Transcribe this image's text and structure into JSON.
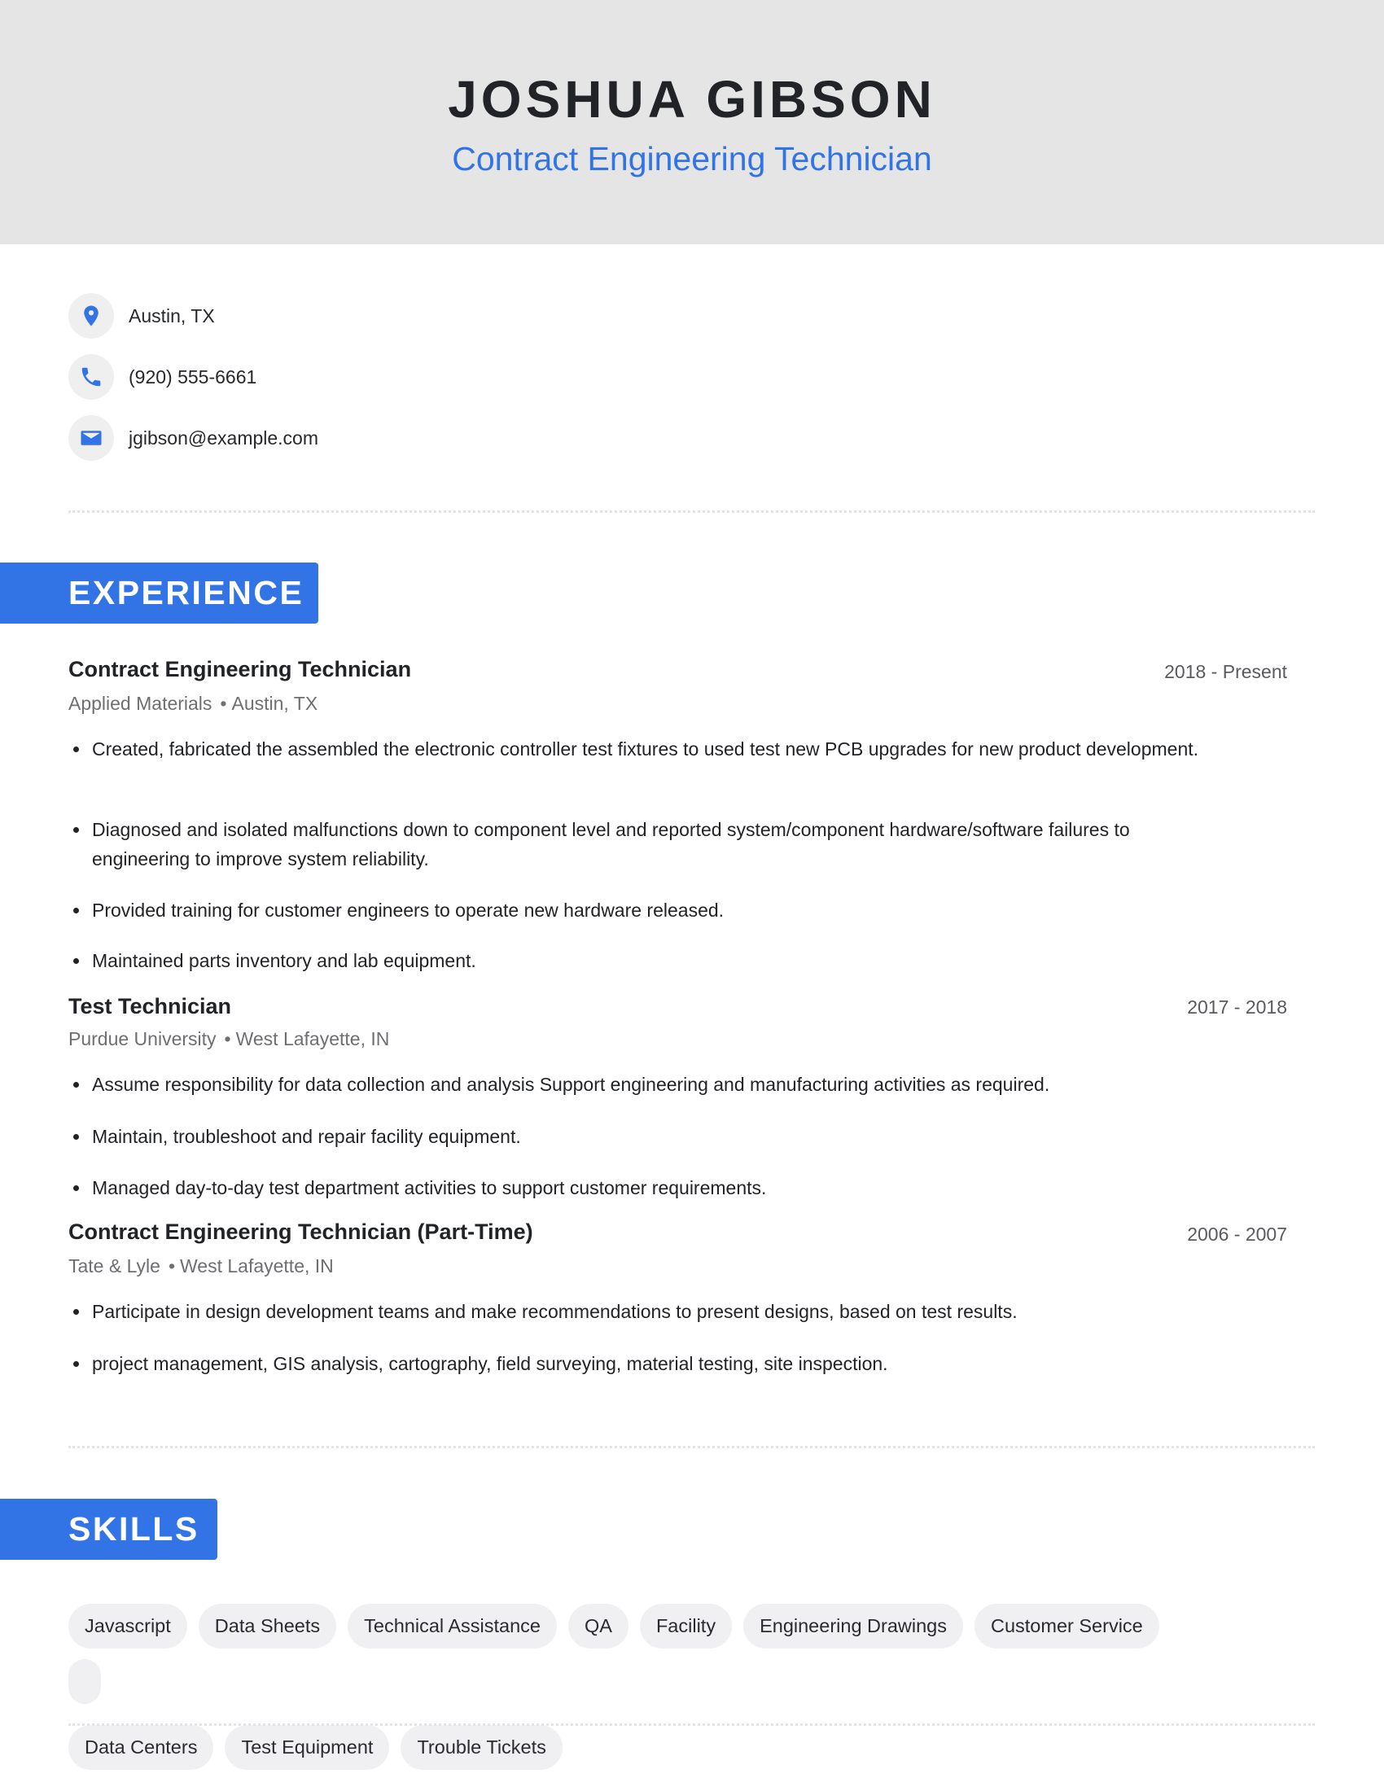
{
  "header": {
    "name": "JOSHUA GIBSON",
    "title": "Contract Engineering Technician"
  },
  "contact": {
    "location": {
      "icon": "location-pin-icon",
      "text": "Austin, TX"
    },
    "phone": {
      "icon": "phone-icon",
      "text": "(920) 555-6661"
    },
    "email": {
      "icon": "email-icon",
      "text": "jgibson@example.com"
    }
  },
  "colors": {
    "accent": "#3274e6",
    "header_bg": "#e5e5e6",
    "pill_bg": "#f0f0f2",
    "text": "#212327"
  },
  "experience": {
    "label": "EXPERIENCE",
    "jobs": [
      {
        "title": "Contract Engineering Technician",
        "dates": "2018 - Present",
        "company": "Applied Materials",
        "location": "Austin, TX",
        "bullets": [
          "Created, fabricated the assembled the electronic controller test fixtures to used test new PCB upgrades for new product development.",
          "Diagnosed and isolated malfunctions down to component level and reported system/component hardware/software failures to engineering to improve system reliability.",
          "Provided training for customer engineers to operate new hardware released.",
          "Maintained parts inventory and lab equipment."
        ]
      },
      {
        "title": "Test Technician",
        "dates": "2017 - 2018",
        "company": "Purdue University",
        "location": "West Lafayette, IN",
        "bullets": [
          "Assume responsibility for data collection and analysis Support engineering and manufacturing activities as required.",
          "Maintain, troubleshoot and repair facility equipment.",
          "Managed day-to-day test department activities to support customer requirements."
        ]
      },
      {
        "title": "Contract Engineering Technician (Part-Time)",
        "dates": "2006 - 2007",
        "company": "Tate & Lyle",
        "location": "West Lafayette, IN",
        "bullets": [
          "Participate in design development teams and make recommendations to present designs, based on test results.",
          "project management, GIS analysis, cartography, field surveying, material testing, site inspection."
        ]
      }
    ]
  },
  "skills": {
    "label": "SKILLS",
    "items": [
      "Javascript",
      "Data Sheets",
      "Technical Assistance",
      "QA",
      "Facility",
      "Engineering Drawings",
      "Customer Service",
      "Data Centers",
      "Test Equipment",
      "Trouble Tickets"
    ]
  }
}
